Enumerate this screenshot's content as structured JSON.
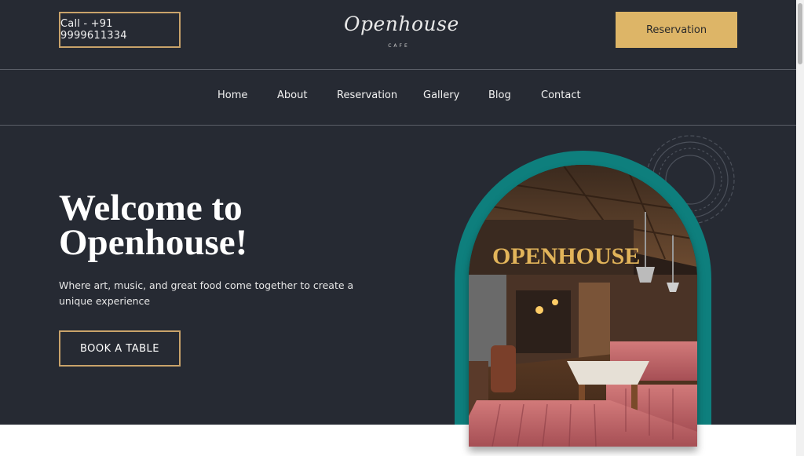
{
  "header": {
    "call_label": "Call - +91 9999611334",
    "logo_text": "Openhouse",
    "logo_subtext": "CAFE",
    "reservation_label": "Reservation"
  },
  "nav": {
    "items": [
      {
        "label": "Home"
      },
      {
        "label": "About"
      },
      {
        "label": "Reservation"
      },
      {
        "label": "Gallery"
      },
      {
        "label": "Blog"
      },
      {
        "label": "Contact"
      }
    ]
  },
  "hero": {
    "title_line1": "Welcome to",
    "title_line2": "Openhouse!",
    "subtitle": "Where art, music, and great food come together to create a unique experience",
    "cta_label": "BOOK A TABLE",
    "image_sign_text": "OPENHOUSE"
  },
  "colors": {
    "background": "#262a33",
    "accent_gold": "#ddb567",
    "outline_gold": "#c9a36a",
    "arch_teal": "#0e7f7d"
  }
}
